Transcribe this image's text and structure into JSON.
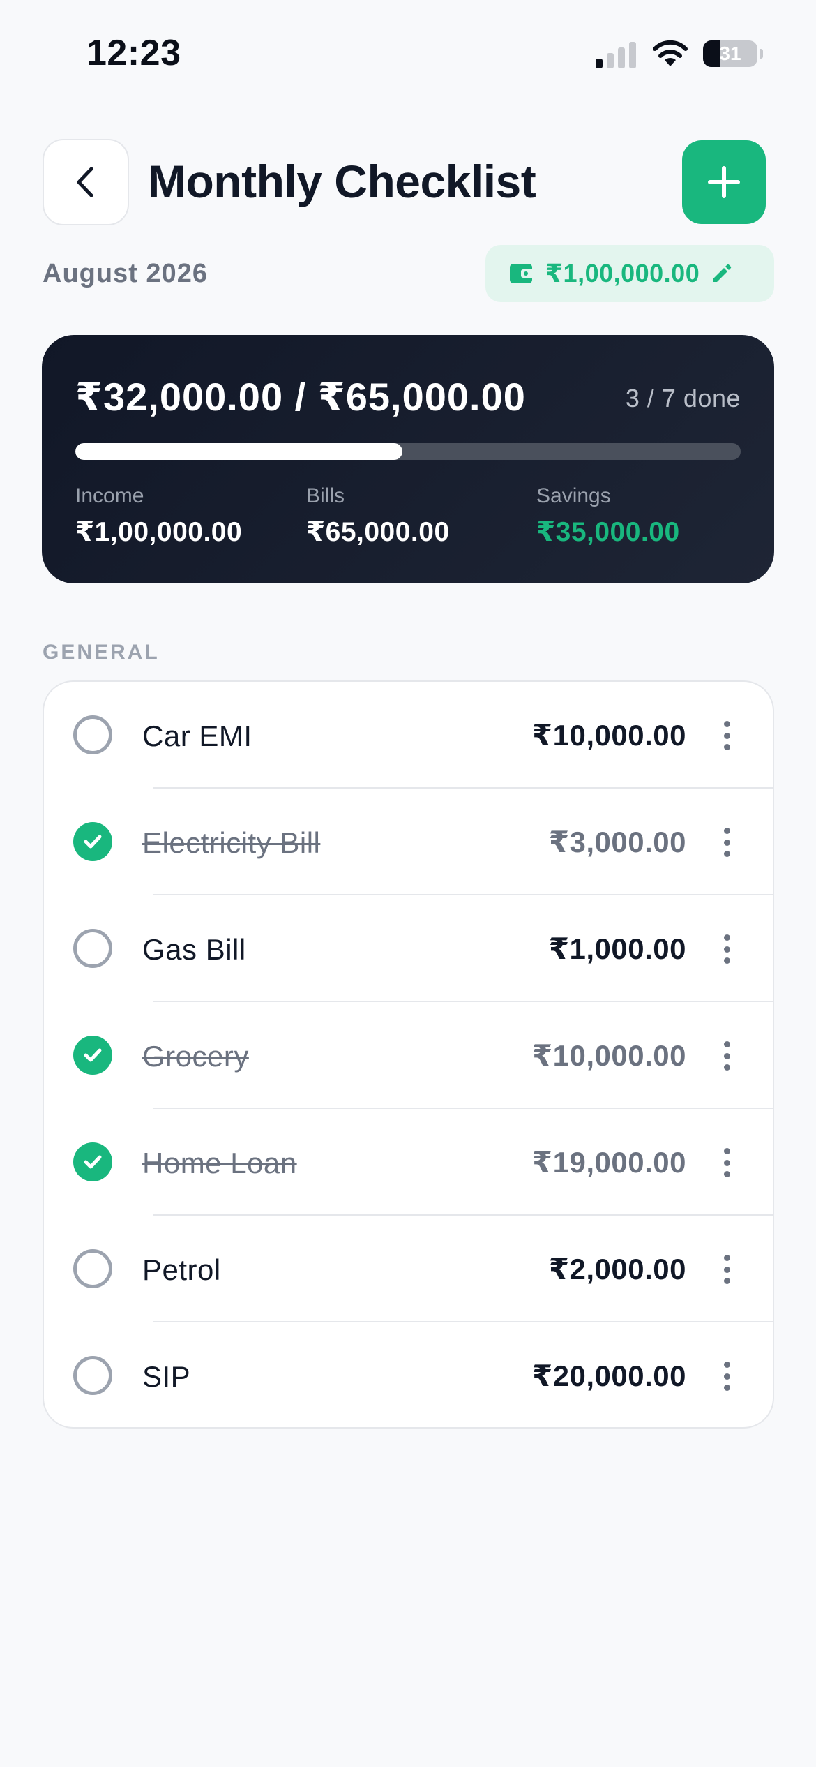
{
  "status_bar": {
    "time": "12:23",
    "battery": "31"
  },
  "header": {
    "title": "Monthly Checklist",
    "month": "August 2026",
    "income_chip": "₹1,00,000.00"
  },
  "summary": {
    "total": "₹32,000.00 / ₹65,000.00",
    "done": "3 / 7 done",
    "progress_fraction": 0.492,
    "income_label": "Income",
    "income_value": "₹1,00,000.00",
    "bills_label": "Bills",
    "bills_value": "₹65,000.00",
    "savings_label": "Savings",
    "savings_value": "₹35,000.00"
  },
  "section": {
    "label": "GENERAL"
  },
  "items": [
    {
      "name": "Car EMI",
      "amount": "₹10,000.00",
      "done": false
    },
    {
      "name": "Electricity Bill",
      "amount": "₹3,000.00",
      "done": true
    },
    {
      "name": "Gas Bill",
      "amount": "₹1,000.00",
      "done": false
    },
    {
      "name": "Grocery",
      "amount": "₹10,000.00",
      "done": true
    },
    {
      "name": "Home Loan",
      "amount": "₹19,000.00",
      "done": true
    },
    {
      "name": "Petrol",
      "amount": "₹2,000.00",
      "done": false
    },
    {
      "name": "SIP",
      "amount": "₹20,000.00",
      "done": false
    }
  ],
  "colors": {
    "accent": "#19b77e",
    "card_dark": "#111727",
    "text_primary": "#111827",
    "text_muted": "#6b7280",
    "background": "#f8f9fb"
  },
  "icons": {
    "back": "chevron-left-icon",
    "add": "plus-icon",
    "wallet": "wallet-icon",
    "edit": "pencil-icon",
    "check": "checkmark-icon",
    "more": "more-vertical-icon"
  }
}
